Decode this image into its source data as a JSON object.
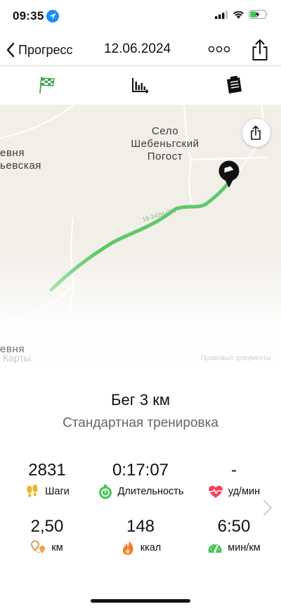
{
  "status_bar": {
    "time": "09:35"
  },
  "nav": {
    "back_label": "Прогресс",
    "date": "12.06.2024"
  },
  "tabs": [
    {
      "icon": "checkered-flag-icon",
      "active": true
    },
    {
      "icon": "bar-chart-icon",
      "active": false
    },
    {
      "icon": "notes-icon",
      "active": false
    }
  ],
  "map": {
    "labels": {
      "village": "Село\nШебеньгский\nПогост",
      "left_village": "евня\nьевская",
      "left_bottom": "евня",
      "road": "19-242Н-029"
    },
    "maps_logo": "Карты",
    "legal": "Правовые документы",
    "route_color": "#5dc96a"
  },
  "workout": {
    "title": "Бег 3 км",
    "subtitle": "Стандартная тренировка"
  },
  "stats": [
    {
      "value": "2831",
      "label": "Шаги",
      "icon": "footprints-icon",
      "color": "#f0b429"
    },
    {
      "value": "0:17:07",
      "label": "Длительность",
      "icon": "stopwatch-icon",
      "color": "#4cc45a"
    },
    {
      "value": "-",
      "label": "уд/мин",
      "icon": "heart-rate-icon",
      "color": "#f2405b"
    },
    {
      "value": "2,50",
      "label": "км",
      "icon": "location-pin-icon",
      "color": "#d7a24e"
    },
    {
      "value": "148",
      "label": "ккал",
      "icon": "flame-icon",
      "color": "#f57a2b"
    },
    {
      "value": "6:50",
      "label": "мин/км",
      "icon": "speedometer-icon",
      "color": "#4cc45a"
    }
  ]
}
